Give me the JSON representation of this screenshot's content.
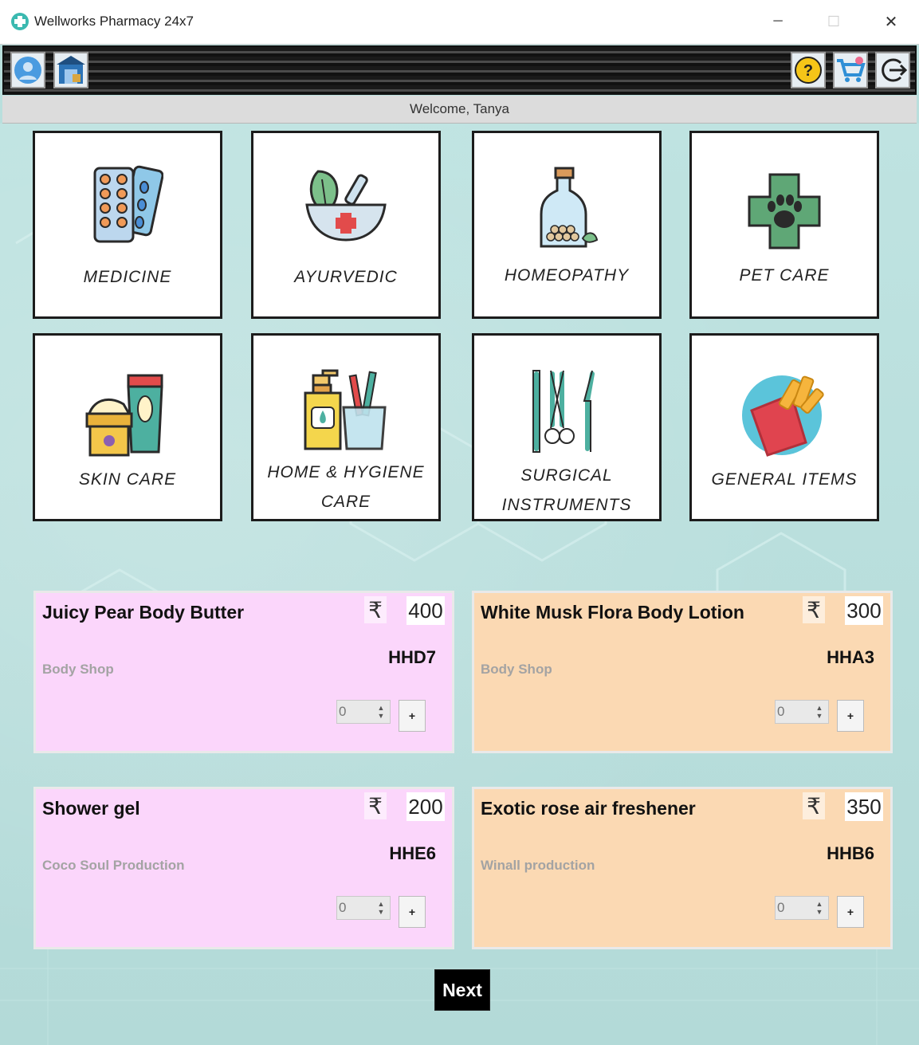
{
  "window": {
    "title": "Wellworks Pharmacy 24x7",
    "minimize_glyph": "─",
    "maximize_glyph": "☐",
    "close_glyph": "✕"
  },
  "toolbar": {
    "left_buttons": [
      "profile-icon",
      "store-icon"
    ],
    "right_buttons": [
      "help-icon",
      "cart-icon",
      "logout-icon"
    ]
  },
  "welcome": "Welcome, Tanya",
  "categories": [
    {
      "label": "MEDICINE",
      "icon": "pill-blister-icon"
    },
    {
      "label": "AYURVEDIC",
      "icon": "mortar-herbs-icon"
    },
    {
      "label": "HOMEOPATHY",
      "icon": "homeopathy-bottle-icon"
    },
    {
      "label": "PET CARE",
      "icon": "paw-cross-icon"
    },
    {
      "label": "SKIN CARE",
      "icon": "cream-tube-icon"
    },
    {
      "label": "HOME & HYGIENE",
      "label2": "CARE",
      "icon": "soap-toothbrush-icon"
    },
    {
      "label": "SURGICAL",
      "label2": "INSTRUMENTS",
      "icon": "surgical-tools-icon"
    },
    {
      "label": "GENERAL ITEMS",
      "icon": "snack-pack-icon"
    }
  ],
  "currency_symbol": "₹",
  "products": [
    {
      "name": "Juicy Pear Body Butter",
      "price": "400",
      "code": "HHD7",
      "brand": "Body Shop",
      "qty": "0",
      "add_label": "+",
      "color": "#fbd6fb"
    },
    {
      "name": "White Musk Flora Body Lotion",
      "price": "300",
      "code": "HHA3",
      "brand": "Body Shop",
      "qty": "0",
      "add_label": "+",
      "color": "#fbd9b3"
    },
    {
      "name": "Shower gel",
      "price": "200",
      "code": "HHE6",
      "brand": "Coco Soul Production",
      "qty": "0",
      "add_label": "+",
      "color": "#fbd6fb"
    },
    {
      "name": "Exotic rose air freshener",
      "price": "350",
      "code": "HHB6",
      "brand": "Winall production",
      "qty": "0",
      "add_label": "+",
      "color": "#fbd9b3"
    }
  ],
  "next_label": "Next",
  "spin_up": "▲",
  "spin_down": "▼"
}
